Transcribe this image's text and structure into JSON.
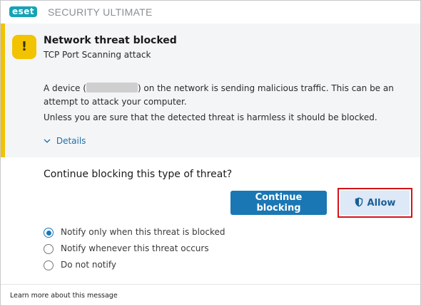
{
  "titlebar": {
    "logo_text": "eset",
    "product_name": "SECURITY ULTIMATE"
  },
  "alert": {
    "icon": "warning-exclamation-icon",
    "icon_glyph": "!",
    "accent_color": "#f2c300",
    "title": "Network threat blocked",
    "subtitle": "TCP Port Scanning attack",
    "description_prefix": "A device (",
    "description_suffix": ") on the network is sending malicious traffic. This can be an attempt to attack your computer.",
    "description_2": "Unless you are sure that the detected threat is harmless it should be blocked.",
    "details_label": "Details"
  },
  "action": {
    "question": "Continue blocking this type of threat?",
    "continue_label": "Continue blocking",
    "allow_label": "Allow",
    "allow_icon": "shield-icon",
    "highlight_color": "#d6121a"
  },
  "notify_options": [
    {
      "label": "Notify only when this threat is blocked",
      "selected": true
    },
    {
      "label": "Notify whenever this threat occurs",
      "selected": false
    },
    {
      "label": "Do not notify",
      "selected": false
    }
  ],
  "footer": {
    "learn_more": "Learn more about this message"
  },
  "colors": {
    "brand": "#16a3b5",
    "primary_button": "#1a77b4",
    "link": "#1f6fa8"
  }
}
